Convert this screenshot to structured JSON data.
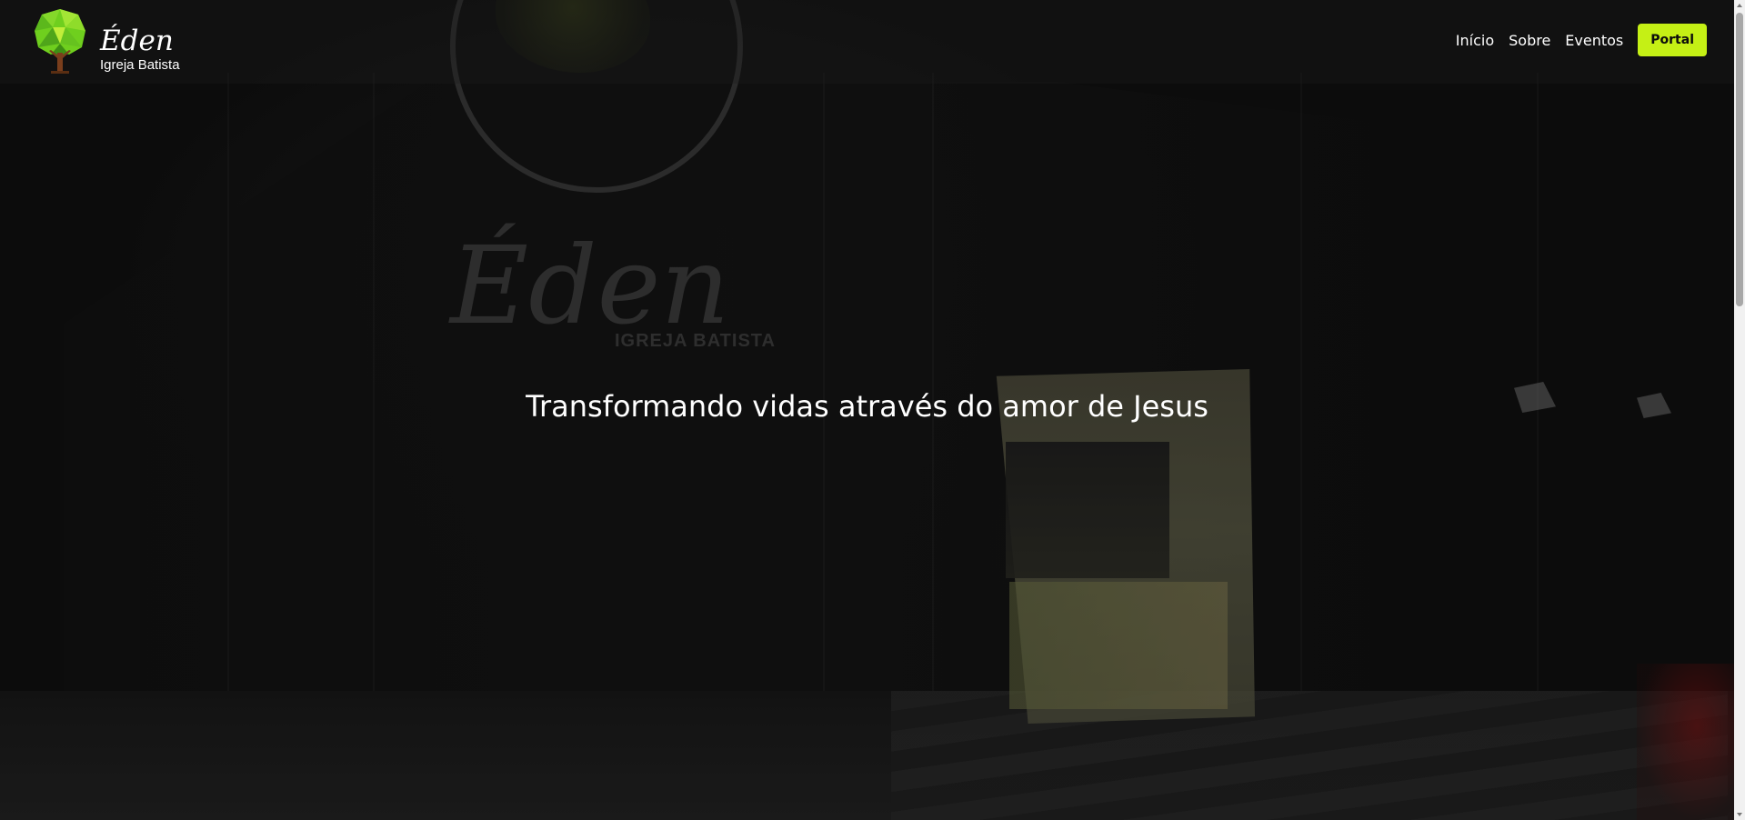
{
  "brand": {
    "name": "Éden",
    "subtitle": "Igreja Batista",
    "logo_icon": "tree-logo-icon"
  },
  "nav": {
    "items": [
      {
        "label": "Início"
      },
      {
        "label": "Sobre"
      },
      {
        "label": "Eventos"
      }
    ],
    "portal_label": "Portal"
  },
  "hero": {
    "headline": "Transformando vidas através do amor de Jesus",
    "sign_text": "Éden",
    "sign_subtext": "IGREJA BATISTA"
  },
  "colors": {
    "accent": "#c5f015",
    "text": "#ffffff",
    "background": "#0f0f0f"
  }
}
